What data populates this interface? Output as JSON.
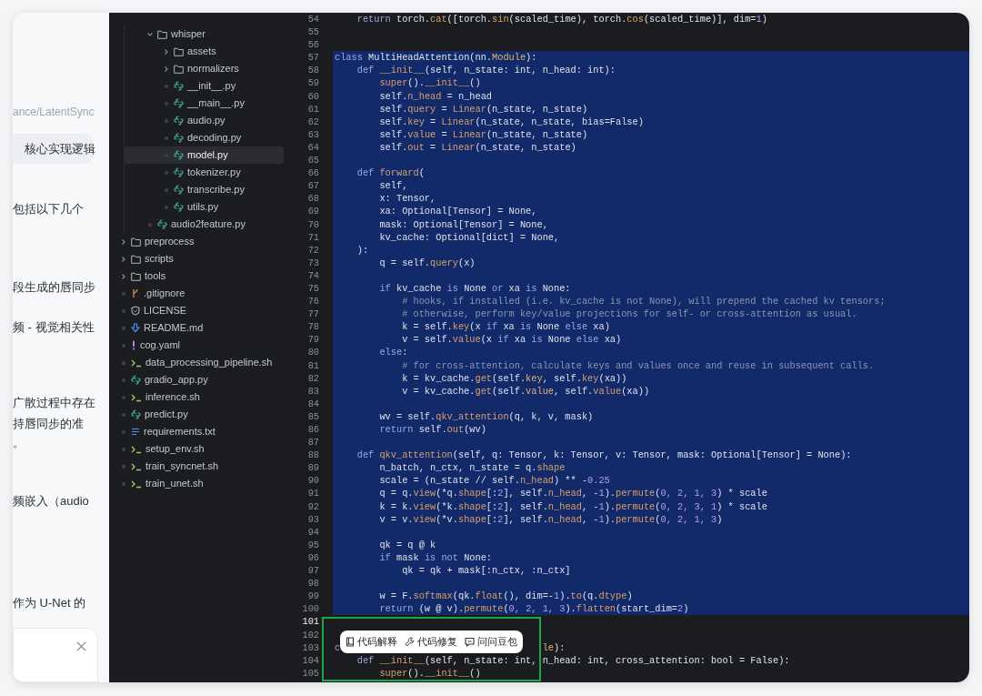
{
  "chat_fragments": [
    {
      "kind": "path",
      "text": "ance/LatentSync"
    },
    {
      "kind": "highlight",
      "text": "核心实现逻辑"
    },
    {
      "kind": "body",
      "text": "包括以下几个"
    },
    {
      "kind": "body",
      "text": "段生成的唇同步"
    },
    {
      "kind": "body",
      "text": "频 - 视觉相关性"
    },
    {
      "kind": "body",
      "text": "广散过程中存在"
    },
    {
      "kind": "body",
      "text": "持唇同步的准"
    },
    {
      "kind": "body",
      "text": "。"
    },
    {
      "kind": "body",
      "text": "频嵌入（audio"
    },
    {
      "kind": "body",
      "text": "作为 U-Net 的"
    }
  ],
  "file_tree": {
    "partial_branch": [
      {
        "name": "whisper",
        "kind": "folder",
        "expanded": true,
        "selected": false,
        "children": [
          {
            "name": "assets",
            "kind": "folder",
            "expanded": false,
            "selected": false
          },
          {
            "name": "normalizers",
            "kind": "folder",
            "expanded": false,
            "selected": false
          },
          {
            "name": "__init__.py",
            "kind": "python",
            "selected": false
          },
          {
            "name": "__main__.py",
            "kind": "python",
            "selected": false
          },
          {
            "name": "audio.py",
            "kind": "python",
            "selected": false
          },
          {
            "name": "decoding.py",
            "kind": "python",
            "selected": false
          },
          {
            "name": "model.py",
            "kind": "python",
            "selected": true
          },
          {
            "name": "tokenizer.py",
            "kind": "python",
            "selected": false
          },
          {
            "name": "transcribe.py",
            "kind": "python",
            "selected": false
          },
          {
            "name": "utils.py",
            "kind": "python",
            "selected": false
          }
        ]
      },
      {
        "name": "audio2feature.py",
        "kind": "python",
        "selected": false
      }
    ],
    "items": [
      {
        "name": "preprocess",
        "kind": "folder",
        "expanded": false,
        "selected": false
      },
      {
        "name": "scripts",
        "kind": "folder",
        "expanded": false,
        "selected": false
      },
      {
        "name": "tools",
        "kind": "folder",
        "expanded": false,
        "selected": false
      },
      {
        "name": ".gitignore",
        "kind": "git",
        "selected": false
      },
      {
        "name": "LICENSE",
        "kind": "license",
        "selected": false
      },
      {
        "name": "README.md",
        "kind": "markdown",
        "selected": false
      },
      {
        "name": "cog.yaml",
        "kind": "yaml",
        "selected": false
      },
      {
        "name": "data_processing_pipeline.sh",
        "kind": "shell",
        "selected": false
      },
      {
        "name": "gradio_app.py",
        "kind": "python",
        "selected": false
      },
      {
        "name": "inference.sh",
        "kind": "shell",
        "selected": false
      },
      {
        "name": "predict.py",
        "kind": "python",
        "selected": false
      },
      {
        "name": "requirements.txt",
        "kind": "text",
        "selected": false
      },
      {
        "name": "setup_env.sh",
        "kind": "shell",
        "selected": false
      },
      {
        "name": "train_syncnet.sh",
        "kind": "shell",
        "selected": false
      },
      {
        "name": "train_unet.sh",
        "kind": "shell",
        "selected": false
      }
    ]
  },
  "editor": {
    "lines": [
      {
        "n": "54",
        "selected": false,
        "current": false,
        "code": [
          {
            "t": "    return",
            "kind": "keyword"
          },
          {
            "t": " torch."
          },
          {
            "t": "cat",
            "kind": "function"
          },
          {
            "t": "([torch."
          },
          {
            "t": "sin",
            "kind": "function"
          },
          {
            "t": "(scaled_time), torch."
          },
          {
            "t": "cos",
            "kind": "function"
          },
          {
            "t": "(scaled_time)], dim="
          },
          {
            "t": "1",
            "kind": "number"
          },
          {
            "t": ")"
          }
        ]
      },
      {
        "n": "55",
        "selected": false,
        "current": false
      },
      {
        "n": "56",
        "selected": false,
        "current": false
      },
      {
        "n": "57",
        "selected": true,
        "current": false,
        "code": [
          {
            "t": "class",
            "kind": "keyword"
          },
          {
            "t": " MultiHeadAttention(nn."
          },
          {
            "t": "Module",
            "kind": "class"
          },
          {
            "t": "):"
          }
        ]
      },
      {
        "n": "58",
        "selected": true,
        "current": false,
        "code": [
          {
            "t": "    def",
            "kind": "keyword"
          },
          {
            "t": " __init__",
            "kind": "function"
          },
          {
            "t": "(self, n_state: int, n_head: int):"
          }
        ]
      },
      {
        "n": "59",
        "selected": true,
        "current": false,
        "code": [
          {
            "t": "        super",
            "kind": "function"
          },
          {
            "t": "()."
          },
          {
            "t": "__init__",
            "kind": "function"
          },
          {
            "t": "()"
          }
        ]
      },
      {
        "n": "60",
        "selected": true,
        "current": false,
        "code": [
          {
            "t": "        self."
          },
          {
            "t": "n_head",
            "kind": "function"
          },
          {
            "t": " = n_head"
          }
        ]
      },
      {
        "n": "61",
        "selected": true,
        "current": false,
        "code": [
          {
            "t": "        self."
          },
          {
            "t": "query",
            "kind": "function"
          },
          {
            "t": " = "
          },
          {
            "t": "Linear",
            "kind": "function"
          },
          {
            "t": "(n_state, n_state)"
          }
        ]
      },
      {
        "n": "62",
        "selected": true,
        "current": false,
        "code": [
          {
            "t": "        self."
          },
          {
            "t": "key",
            "kind": "function"
          },
          {
            "t": " = "
          },
          {
            "t": "Linear",
            "kind": "function"
          },
          {
            "t": "(n_state, n_state, bias=False)"
          }
        ]
      },
      {
        "n": "63",
        "selected": true,
        "current": false,
        "code": [
          {
            "t": "        self."
          },
          {
            "t": "value",
            "kind": "function"
          },
          {
            "t": " = "
          },
          {
            "t": "Linear",
            "kind": "function"
          },
          {
            "t": "(n_state, n_state)"
          }
        ]
      },
      {
        "n": "64",
        "selected": true,
        "current": false,
        "code": [
          {
            "t": "        self."
          },
          {
            "t": "out",
            "kind": "function"
          },
          {
            "t": " = "
          },
          {
            "t": "Linear",
            "kind": "function"
          },
          {
            "t": "(n_state, n_state)"
          }
        ]
      },
      {
        "n": "65",
        "selected": true,
        "current": false
      },
      {
        "n": "66",
        "selected": true,
        "current": false,
        "code": [
          {
            "t": "    def",
            "kind": "keyword"
          },
          {
            "t": " forward",
            "kind": "function"
          },
          {
            "t": "("
          }
        ]
      },
      {
        "n": "67",
        "selected": true,
        "current": false,
        "code": [
          {
            "t": "        self,"
          }
        ]
      },
      {
        "n": "68",
        "selected": true,
        "current": false,
        "code": [
          {
            "t": "        x: Tensor,"
          }
        ]
      },
      {
        "n": "69",
        "selected": true,
        "current": false,
        "code": [
          {
            "t": "        xa: Optional[Tensor] = None,"
          }
        ]
      },
      {
        "n": "70",
        "selected": true,
        "current": false,
        "code": [
          {
            "t": "        mask: Optional[Tensor] = None,"
          }
        ]
      },
      {
        "n": "71",
        "selected": true,
        "current": false,
        "code": [
          {
            "t": "        kv_cache: Optional[dict] = None,"
          }
        ]
      },
      {
        "n": "72",
        "selected": true,
        "current": false,
        "code": [
          {
            "t": "    ):"
          }
        ]
      },
      {
        "n": "73",
        "selected": true,
        "current": false,
        "code": [
          {
            "t": "        q = self."
          },
          {
            "t": "query",
            "kind": "function"
          },
          {
            "t": "(x)"
          }
        ]
      },
      {
        "n": "74",
        "selected": true,
        "current": false
      },
      {
        "n": "75",
        "selected": true,
        "current": false,
        "code": [
          {
            "t": "        if",
            "kind": "keyword"
          },
          {
            "t": " kv_cache "
          },
          {
            "t": "is",
            "kind": "keyword"
          },
          {
            "t": " None "
          },
          {
            "t": "or",
            "kind": "keyword"
          },
          {
            "t": " xa "
          },
          {
            "t": "is",
            "kind": "keyword"
          },
          {
            "t": " None:"
          }
        ]
      },
      {
        "n": "76",
        "selected": true,
        "current": false,
        "code": [
          {
            "t": "            # hooks, if installed (i.e. kv_cache is not None), will prepend the cached kv tensors;",
            "kind": "comment"
          }
        ]
      },
      {
        "n": "77",
        "selected": true,
        "current": false,
        "code": [
          {
            "t": "            # otherwise, perform key/value projections for self- or cross-attention as usual.",
            "kind": "comment"
          }
        ]
      },
      {
        "n": "78",
        "selected": true,
        "current": false,
        "code": [
          {
            "t": "            k = self."
          },
          {
            "t": "key",
            "kind": "function"
          },
          {
            "t": "(x "
          },
          {
            "t": "if",
            "kind": "keyword"
          },
          {
            "t": " xa "
          },
          {
            "t": "is",
            "kind": "keyword"
          },
          {
            "t": " None "
          },
          {
            "t": "else",
            "kind": "keyword"
          },
          {
            "t": " xa)"
          }
        ]
      },
      {
        "n": "79",
        "selected": true,
        "current": false,
        "code": [
          {
            "t": "            v = self."
          },
          {
            "t": "value",
            "kind": "function"
          },
          {
            "t": "(x "
          },
          {
            "t": "if",
            "kind": "keyword"
          },
          {
            "t": " xa "
          },
          {
            "t": "is",
            "kind": "keyword"
          },
          {
            "t": " None "
          },
          {
            "t": "else",
            "kind": "keyword"
          },
          {
            "t": " xa)"
          }
        ]
      },
      {
        "n": "80",
        "selected": true,
        "current": false,
        "code": [
          {
            "t": "        else",
            "kind": "keyword"
          },
          {
            "t": ":"
          }
        ]
      },
      {
        "n": "81",
        "selected": true,
        "current": false,
        "code": [
          {
            "t": "            # for cross-attention, calculate keys and values once and reuse in subsequent calls.",
            "kind": "comment"
          }
        ]
      },
      {
        "n": "82",
        "selected": true,
        "current": false,
        "code": [
          {
            "t": "            k = kv_cache."
          },
          {
            "t": "get",
            "kind": "function"
          },
          {
            "t": "(self."
          },
          {
            "t": "key",
            "kind": "class"
          },
          {
            "t": ", self."
          },
          {
            "t": "key",
            "kind": "function"
          },
          {
            "t": "(xa))"
          }
        ]
      },
      {
        "n": "83",
        "selected": true,
        "current": false,
        "code": [
          {
            "t": "            v = kv_cache."
          },
          {
            "t": "get",
            "kind": "function"
          },
          {
            "t": "(self."
          },
          {
            "t": "value",
            "kind": "class"
          },
          {
            "t": ", self."
          },
          {
            "t": "value",
            "kind": "function"
          },
          {
            "t": "(xa))"
          }
        ]
      },
      {
        "n": "84",
        "selected": true,
        "current": false
      },
      {
        "n": "85",
        "selected": true,
        "current": false,
        "code": [
          {
            "t": "        wv = self."
          },
          {
            "t": "qkv_attention",
            "kind": "function"
          },
          {
            "t": "(q, k, v, mask)"
          }
        ]
      },
      {
        "n": "86",
        "selected": true,
        "current": false,
        "code": [
          {
            "t": "        return",
            "kind": "keyword"
          },
          {
            "t": " self."
          },
          {
            "t": "out",
            "kind": "function"
          },
          {
            "t": "(wv)"
          }
        ]
      },
      {
        "n": "87",
        "selected": true,
        "current": false
      },
      {
        "n": "88",
        "selected": true,
        "current": false,
        "code": [
          {
            "t": "    def",
            "kind": "keyword"
          },
          {
            "t": " qkv_attention",
            "kind": "function"
          },
          {
            "t": "(self, q: Tensor, k: Tensor, v: Tensor, mask: Optional[Tensor] = None):"
          }
        ]
      },
      {
        "n": "89",
        "selected": true,
        "current": false,
        "code": [
          {
            "t": "        n_batch, n_ctx, n_state = q."
          },
          {
            "t": "shape",
            "kind": "function"
          }
        ]
      },
      {
        "n": "90",
        "selected": true,
        "current": false,
        "code": [
          {
            "t": "        scale = (n_state // self."
          },
          {
            "t": "n_head",
            "kind": "function"
          },
          {
            "t": ") ** -"
          },
          {
            "t": "0.25",
            "kind": "number"
          }
        ]
      },
      {
        "n": "91",
        "selected": true,
        "current": false,
        "code": [
          {
            "t": "        q = q."
          },
          {
            "t": "view",
            "kind": "function"
          },
          {
            "t": "(*q."
          },
          {
            "t": "shape",
            "kind": "function"
          },
          {
            "t": "[:"
          },
          {
            "t": "2",
            "kind": "number"
          },
          {
            "t": "], self."
          },
          {
            "t": "n_head",
            "kind": "function"
          },
          {
            "t": ", -"
          },
          {
            "t": "1",
            "kind": "number"
          },
          {
            "t": ")."
          },
          {
            "t": "permute",
            "kind": "function"
          },
          {
            "t": "("
          },
          {
            "t": "0, 2, 1, 3",
            "kind": "number"
          },
          {
            "t": ") * scale"
          }
        ]
      },
      {
        "n": "92",
        "selected": true,
        "current": false,
        "code": [
          {
            "t": "        k = k."
          },
          {
            "t": "view",
            "kind": "function"
          },
          {
            "t": "(*k."
          },
          {
            "t": "shape",
            "kind": "function"
          },
          {
            "t": "[:"
          },
          {
            "t": "2",
            "kind": "number"
          },
          {
            "t": "], self."
          },
          {
            "t": "n_head",
            "kind": "function"
          },
          {
            "t": ", -"
          },
          {
            "t": "1",
            "kind": "number"
          },
          {
            "t": ")."
          },
          {
            "t": "permute",
            "kind": "function"
          },
          {
            "t": "("
          },
          {
            "t": "0, 2, 3, 1",
            "kind": "number"
          },
          {
            "t": ") * scale"
          }
        ]
      },
      {
        "n": "93",
        "selected": true,
        "current": false,
        "code": [
          {
            "t": "        v = v."
          },
          {
            "t": "view",
            "kind": "function"
          },
          {
            "t": "(*v."
          },
          {
            "t": "shape",
            "kind": "function"
          },
          {
            "t": "[:"
          },
          {
            "t": "2",
            "kind": "number"
          },
          {
            "t": "], self."
          },
          {
            "t": "n_head",
            "kind": "function"
          },
          {
            "t": ", -"
          },
          {
            "t": "1",
            "kind": "number"
          },
          {
            "t": ")."
          },
          {
            "t": "permute",
            "kind": "function"
          },
          {
            "t": "("
          },
          {
            "t": "0, 2, 1, 3",
            "kind": "number"
          },
          {
            "t": ")"
          }
        ]
      },
      {
        "n": "94",
        "selected": true,
        "current": false
      },
      {
        "n": "95",
        "selected": true,
        "current": false,
        "code": [
          {
            "t": "        qk = q @ k"
          }
        ]
      },
      {
        "n": "96",
        "selected": true,
        "current": false,
        "code": [
          {
            "t": "        if",
            "kind": "keyword"
          },
          {
            "t": " mask "
          },
          {
            "t": "is not",
            "kind": "keyword"
          },
          {
            "t": " None:"
          }
        ]
      },
      {
        "n": "97",
        "selected": true,
        "current": false,
        "code": [
          {
            "t": "            qk = qk + mask[:n_ctx, :n_ctx]"
          }
        ]
      },
      {
        "n": "98",
        "selected": true,
        "current": false
      },
      {
        "n": "99",
        "selected": true,
        "current": false,
        "code": [
          {
            "t": "        w = F."
          },
          {
            "t": "softmax",
            "kind": "function"
          },
          {
            "t": "(qk."
          },
          {
            "t": "float",
            "kind": "function"
          },
          {
            "t": "(), dim=-"
          },
          {
            "t": "1",
            "kind": "number"
          },
          {
            "t": ")."
          },
          {
            "t": "to",
            "kind": "function"
          },
          {
            "t": "(q."
          },
          {
            "t": "dtype",
            "kind": "function"
          },
          {
            "t": ")"
          }
        ]
      },
      {
        "n": "100",
        "selected": true,
        "current": false,
        "code": [
          {
            "t": "        return",
            "kind": "keyword"
          },
          {
            "t": " (w @ v)."
          },
          {
            "t": "permute",
            "kind": "function"
          },
          {
            "t": "("
          },
          {
            "t": "0, 2, 1, 3",
            "kind": "number"
          },
          {
            "t": ")."
          },
          {
            "t": "flatten",
            "kind": "function"
          },
          {
            "t": "(start_dim="
          },
          {
            "t": "2",
            "kind": "number"
          },
          {
            "t": ")"
          }
        ]
      },
      {
        "n": "101",
        "selected": false,
        "current": true
      },
      {
        "n": "102",
        "selected": false,
        "current": false
      },
      {
        "n": "103",
        "selected": false,
        "current": false,
        "code": [
          {
            "t": "c",
            "kind": "keyword"
          }
        ],
        "code_after_popup": [
          {
            "t": "le",
            "kind": "class"
          },
          {
            "t": "):"
          }
        ]
      },
      {
        "n": "104",
        "selected": false,
        "current": false,
        "code": [
          {
            "t": "    def",
            "kind": "keyword"
          },
          {
            "t": " __init__",
            "kind": "function"
          },
          {
            "t": "(self, n_state: int, n_head: int, cross_attention: bool = False):"
          }
        ]
      },
      {
        "n": "105",
        "selected": false,
        "current": false,
        "code": [
          {
            "t": "        super",
            "kind": "function"
          },
          {
            "t": "()."
          },
          {
            "t": "__init__",
            "kind": "function"
          },
          {
            "t": "()"
          }
        ]
      }
    ]
  },
  "popup_actions": [
    {
      "label": "代码解释",
      "kind": "explain"
    },
    {
      "label": "代码修复",
      "kind": "fix"
    },
    {
      "label": "问问豆包",
      "kind": "ask"
    }
  ]
}
